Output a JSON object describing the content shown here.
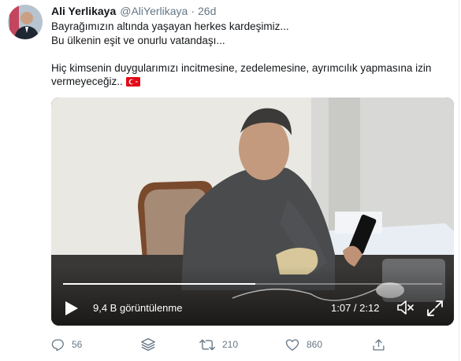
{
  "tweet": {
    "display_name": "Ali Yerlikaya",
    "handle": "@AliYerlikaya",
    "separator": "·",
    "time": "26d",
    "lines": [
      "Bayrağımızın altında yaşayan herkes kardeşimiz...",
      "Bu ülkenin eşit ve onurlu vatandaşı...",
      "",
      "Hiç kimsenin duygularımızı incitmesine, zedelemesine, ayrımcılık yapmasına izin vermeyeceğiz.."
    ],
    "flag_emoji": "turkey-flag-icon"
  },
  "video": {
    "views": "9,4 B görüntülenme",
    "time": "1:07 / 2:12",
    "progress": 0.507
  },
  "actions": {
    "reply_count": "56",
    "retweet_count": "210",
    "like_count": "860"
  },
  "colors": {
    "muted": "#657786",
    "text": "#14171a",
    "flag_red": "#e30a17"
  }
}
